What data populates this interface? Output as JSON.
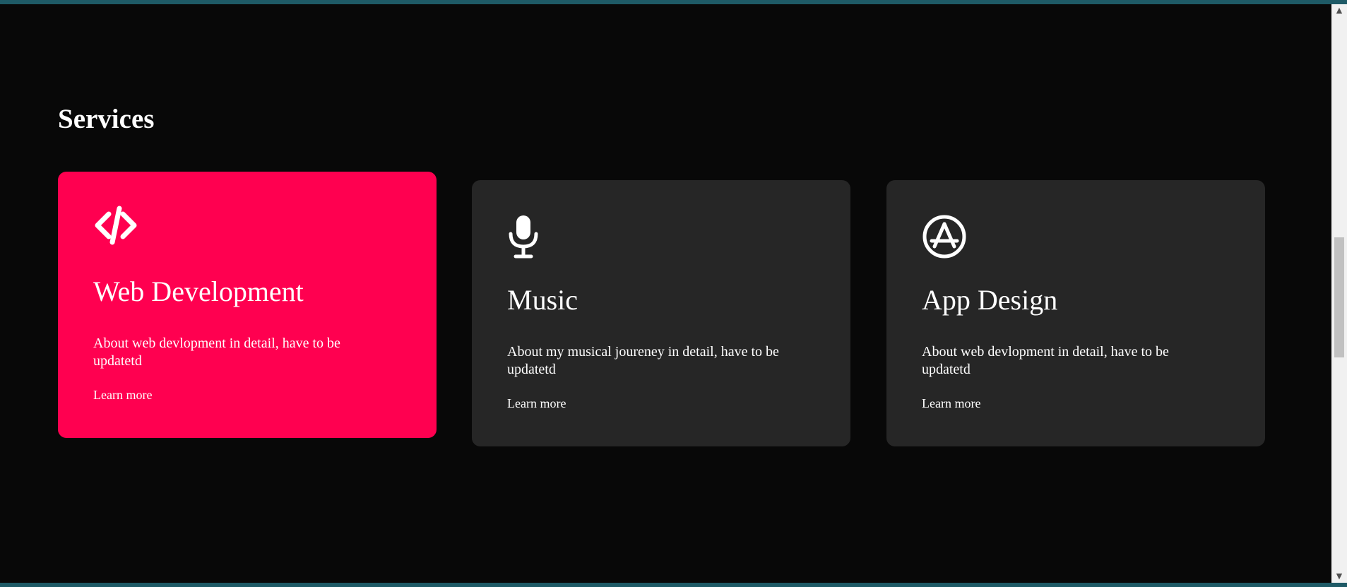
{
  "services": {
    "title": "Services",
    "cards": [
      {
        "icon": "code-icon",
        "title": "Web Development",
        "description": "About web devlopment in detail, have to be updatetd",
        "link": "Learn more",
        "active": true
      },
      {
        "icon": "microphone-icon",
        "title": "Music",
        "description": "About my musical joureney in detail, have to be updatetd",
        "link": "Learn more",
        "active": false
      },
      {
        "icon": "app-store-icon",
        "title": "App Design",
        "description": "About web devlopment in detail, have to be updatetd",
        "link": "Learn more",
        "active": false
      }
    ]
  },
  "colors": {
    "background": "#080808",
    "card": "#262626",
    "accent": "#ff0050",
    "text": "#ffffff",
    "frame": "#1e5a66"
  },
  "scrollbar": {
    "up_arrow": "▲",
    "down_arrow": "▼"
  }
}
